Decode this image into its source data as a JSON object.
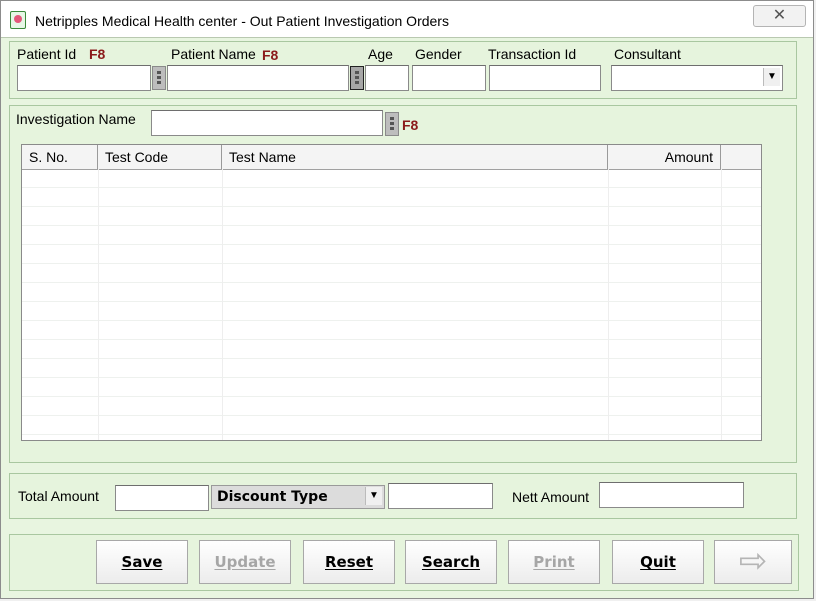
{
  "window": {
    "title": "Netripples Medical Health center - Out Patient Investigation Orders",
    "close_glyph": "✕"
  },
  "patient": {
    "patient_id_label": "Patient Id",
    "patient_name_label": "Patient Name",
    "age_label": "Age",
    "gender_label": "Gender",
    "transaction_id_label": "Transaction Id",
    "consultant_label": "Consultant",
    "f8_hint": "F8",
    "patient_id_value": "",
    "patient_name_value": "",
    "age_value": "",
    "gender_value": "",
    "transaction_id_value": "",
    "consultant_value": ""
  },
  "investigation": {
    "name_label": "Investigation Name",
    "name_value": "",
    "f8_hint": "F8"
  },
  "grid": {
    "columns": [
      "S. No.",
      "Test Code",
      "Test Name",
      "Amount"
    ],
    "rows": []
  },
  "totals": {
    "total_amount_label": "Total Amount",
    "total_amount_value": "",
    "discount_type_label": "Discount Type",
    "discount_value": "",
    "nett_amount_label": "Nett Amount",
    "nett_amount_value": ""
  },
  "buttons": {
    "save": "Save",
    "update": "Update",
    "reset": "Reset",
    "search": "Search",
    "print": "Print",
    "quit": "Quit",
    "next_glyph": "⇨"
  },
  "colors": {
    "panel_bg": "#e6f4dd",
    "hint_red": "#8b1a1a"
  },
  "icons": {
    "app": "app-flower-icon",
    "lookup": "lookup-dots-icon",
    "next": "next-arrow-icon"
  }
}
